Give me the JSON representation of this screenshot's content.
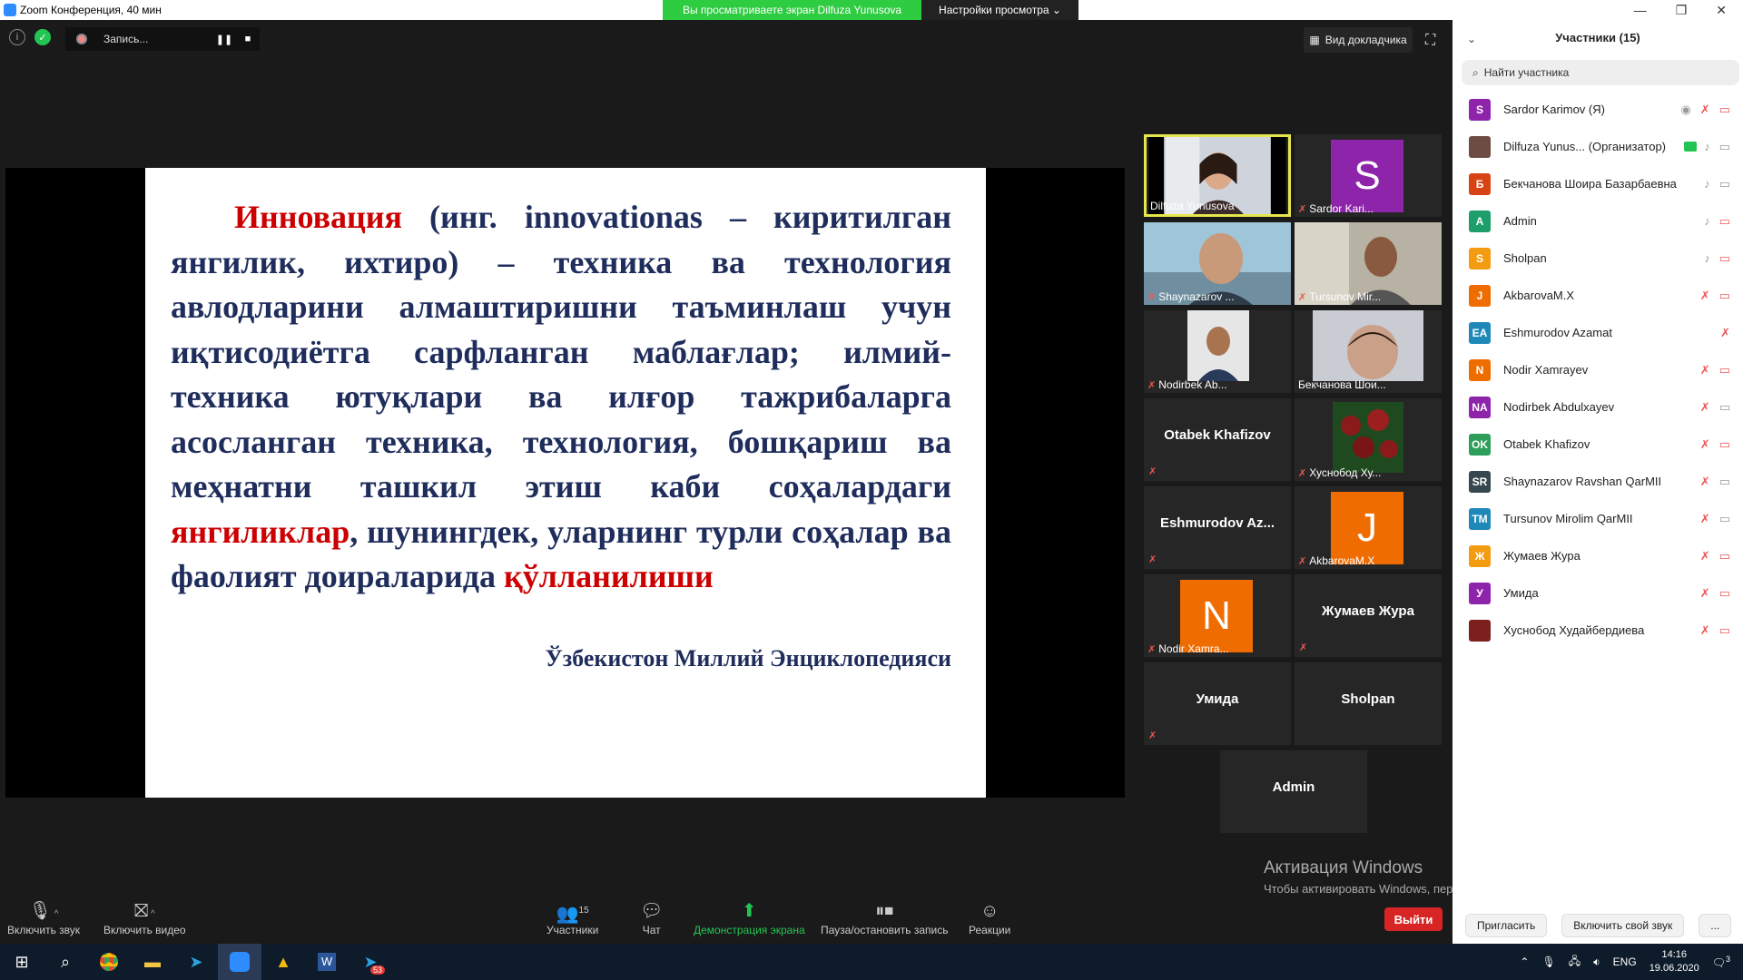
{
  "window": {
    "title": "Zoom Конференция, 40 мин"
  },
  "share_banner": {
    "viewing": "Вы просматриваете экран Dilfuza Yunusova",
    "view_options": "Настройки просмотра ⌄"
  },
  "recording": {
    "label": "Запись...",
    "pause": "❚❚",
    "stop": "■"
  },
  "top_controls": {
    "speaker_view": "Вид докладчика"
  },
  "slide": {
    "p1": "Инновация",
    "p2": " (инг. innovationas – киритилган янгилик, ихтиро) – техника ва технология авлодларини алмаштиришни таъминлаш учун иқтисодиётга сарфланган маблағлар; илмий-техника ютуқлари ва илғор тажрибаларга асосланган техника, технология, бошқариш ва меҳнатни ташкил этиш каби соҳалардаги ",
    "p3": "янгиликлар",
    "p4": ", шунингдек, уларнинг турли соҳалар ва фаолият доираларида ",
    "p5": "қўлланилиши",
    "source": "Ўзбекистон Миллий Энциклопедияси"
  },
  "tiles": [
    {
      "name": "Dilfuza Yunusova"
    },
    {
      "name": "Sardor Kari...",
      "initial": "S"
    },
    {
      "name": "Shaynazarov ..."
    },
    {
      "name": "Tursunov Mir..."
    },
    {
      "name": "Nodirbek Ab..."
    },
    {
      "name": "Бекчанова Шои..."
    },
    {
      "name": "Otabek Khafizov"
    },
    {
      "name": "Хуснобод Ху..."
    },
    {
      "name": "Eshmurodov  Az..."
    },
    {
      "name": "AkbarovaM.X",
      "initial": "J"
    },
    {
      "name": "Nodir Xamra...",
      "initial": "N"
    },
    {
      "name": "Жумаев Жура"
    },
    {
      "name": "Умида"
    },
    {
      "name": "Sholpan"
    },
    {
      "name": "Admin"
    }
  ],
  "panel": {
    "title": "Участники (15)",
    "search_placeholder": "Найти участника",
    "participants": [
      {
        "initial": "S",
        "name": "Sardor Karimov (Я)",
        "color": "#8e24aa"
      },
      {
        "initial": "",
        "name": "Dilfuza Yunus...  (Организатор)",
        "color": "#6d4c41"
      },
      {
        "initial": "Б",
        "name": "Бекчанова Шоира Базарбаевна",
        "color": "#d84315"
      },
      {
        "initial": "A",
        "name": "Admin",
        "color": "#1e9e6a"
      },
      {
        "initial": "S",
        "name": "Sholpan",
        "color": "#f39c12"
      },
      {
        "initial": "J",
        "name": "AkbarovaM.X",
        "color": "#ef6c00"
      },
      {
        "initial": "EA",
        "name": "Eshmurodov Azamat",
        "color": "#1e88b8"
      },
      {
        "initial": "N",
        "name": "Nodir Xamrayev",
        "color": "#ef6c00"
      },
      {
        "initial": "NA",
        "name": "Nodirbek Abdulxayev",
        "color": "#8e24aa"
      },
      {
        "initial": "OK",
        "name": "Otabek Khafizov",
        "color": "#2e9e5b"
      },
      {
        "initial": "SR",
        "name": "Shaynazarov Ravshan QarMII",
        "color": "#37474f"
      },
      {
        "initial": "TM",
        "name": "Tursunov Mirolim QarMII",
        "color": "#1e88b8"
      },
      {
        "initial": "Ж",
        "name": "Жумаев Жура",
        "color": "#f39c12"
      },
      {
        "initial": "У",
        "name": "Умида",
        "color": "#8e24aa"
      },
      {
        "initial": "",
        "name": "Хуснобод Худайбердиева",
        "color": "#7b1f1f"
      }
    ],
    "invite": "Пригласить",
    "unmute_me": "Включить свой звук",
    "more": "..."
  },
  "toolbar": {
    "audio": "Включить звук",
    "video": "Включить видео",
    "participants": "Участники",
    "participants_count": "15",
    "chat": "Чат",
    "share": "Демонстрация экрана",
    "record": "Пауза/остановить запись",
    "reactions": "Реакции",
    "leave": "Выйти"
  },
  "watermark": {
    "line1": "Активация Windows",
    "line2": "Чтобы активировать Windows, перейдите в раздел \"Параметры\"."
  },
  "taskbar": {
    "lang": "ENG",
    "time": "14:16",
    "date": "19.06.2020",
    "notif_badge": "53",
    "notif_count": "3"
  },
  "colors": {
    "accent": "#2d8cff",
    "share_green": "#2ecc40",
    "leave_red": "#d72525",
    "active_speaker": "#e6e64e"
  }
}
